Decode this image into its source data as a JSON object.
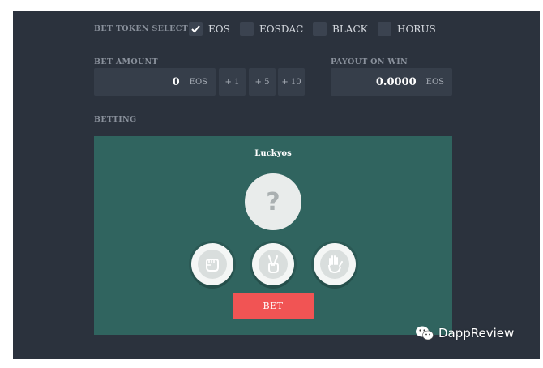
{
  "token_select": {
    "label": "BET TOKEN SELECT",
    "options": [
      {
        "label": "EOS",
        "checked": true
      },
      {
        "label": "EOSDAC",
        "checked": false
      },
      {
        "label": "BLACK",
        "checked": false
      },
      {
        "label": "HORUS",
        "checked": false
      }
    ]
  },
  "bet_amount": {
    "label": "BET AMOUNT",
    "value": "0",
    "unit": "EOS",
    "increments": [
      "+ 1",
      "+ 5",
      "+ 10"
    ]
  },
  "payout": {
    "label": "PAYOUT ON WIN",
    "value": "0.0000",
    "unit": "EOS"
  },
  "betting": {
    "label": "BETTING",
    "game_title": "Luckyos",
    "mystery_symbol": "?",
    "choices": [
      {
        "icon": "rock-hand-icon"
      },
      {
        "icon": "scissors-hand-icon"
      },
      {
        "icon": "paper-hand-icon"
      }
    ],
    "bet_label": "BET"
  },
  "watermark": {
    "text": "DappReview",
    "icon": "wechat-icon"
  },
  "colors": {
    "page_bg": "#2b323d",
    "field_bg": "#363e4a",
    "board_bg": "#30645f",
    "bet_button": "#f15454"
  }
}
